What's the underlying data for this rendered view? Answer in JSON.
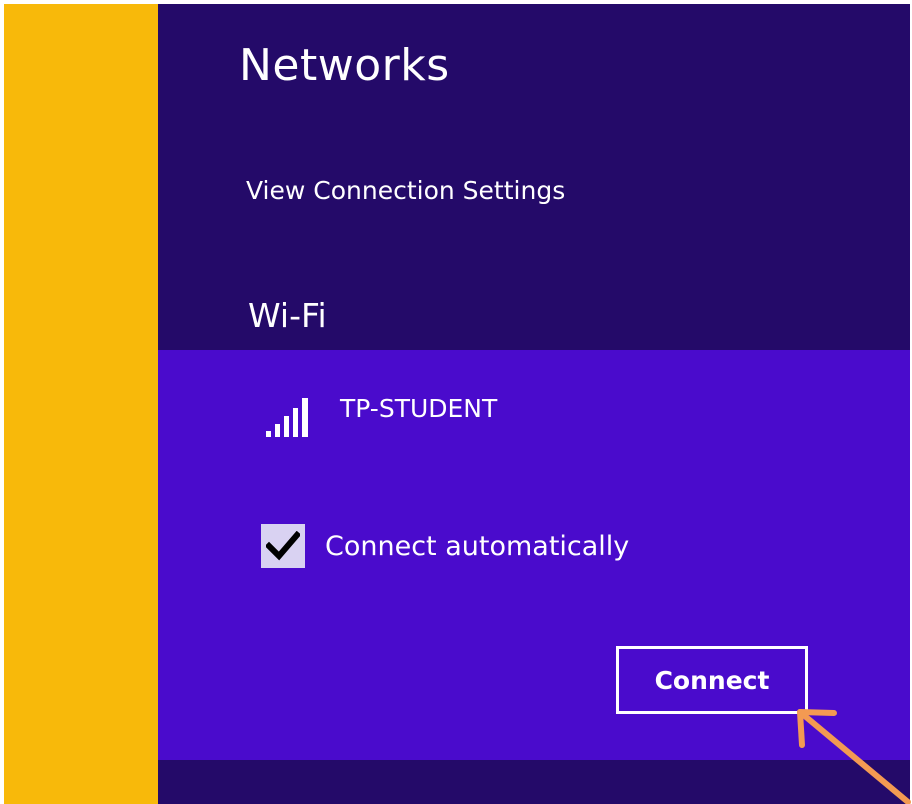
{
  "networks_panel": {
    "title": "Networks",
    "view_connection_settings": "View Connection Settings",
    "section_heading": "Wi-Fi",
    "network": {
      "name": "TP-STUDENT",
      "signal_bars": 5,
      "connect_automatically": {
        "label": "Connect automatically",
        "checked": true
      },
      "connect_button_label": "Connect"
    }
  },
  "icons": {
    "signal": "wifi-signal-icon",
    "check": "checkmark-icon",
    "annotation_arrow": "arrow-icon"
  },
  "colors": {
    "desktop_background": "#f8b90a",
    "panel_background": "#240a69",
    "selected_network_background": "#4a0bcc",
    "text": "#ffffff",
    "checkbox_fill": "#d9d2f2",
    "annotation_arrow": "#f39a52"
  }
}
